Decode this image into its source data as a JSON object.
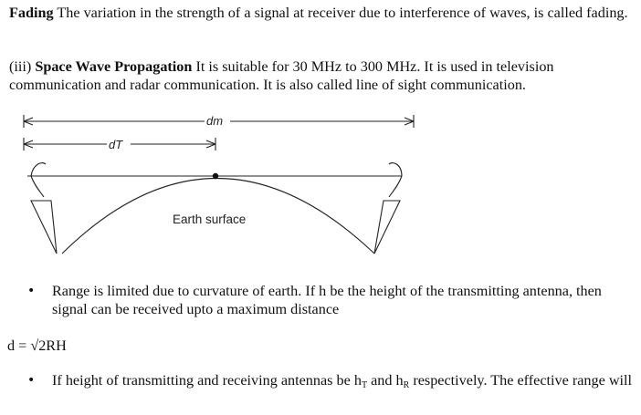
{
  "fading": {
    "term": "Fading",
    "text": "The variation in the strength of a signal at receiver due to interference of waves, is called fading."
  },
  "space_wave": {
    "prefix": "(iii) ",
    "term": "Space Wave Propagation",
    "text": "It is suitable for 30 MHz to 300 MHz. It is used in television communication and radar communication. It is also called line of sight communication."
  },
  "diagram": {
    "label_dm": "dm",
    "label_dT": "dT",
    "label_earth": "Earth surface"
  },
  "bullets": {
    "b1": "Range is limited due to curvature of earth. If h be the height of the transmitting antenna, then signal can be received upto a maximum distance",
    "b2_before": "If height of transmitting and receiving antennas be h",
    "b2_sub1": "T",
    "b2_mid": " and h",
    "b2_sub2": "R",
    "b2_after": " respectively. The effective range will",
    "dot": "•"
  },
  "formula": "d = √2RH"
}
